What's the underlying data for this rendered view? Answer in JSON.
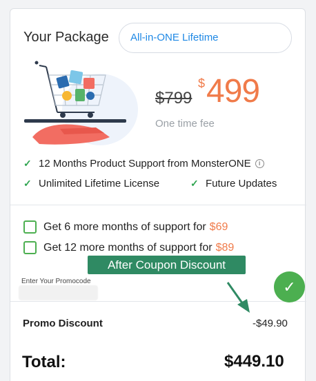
{
  "package": {
    "heading": "Your Package",
    "plan_name": "All-in-ONE Lifetime"
  },
  "pricing": {
    "old_price": "$799",
    "currency": "$",
    "new_price": "499",
    "fee_note": "One time fee"
  },
  "features": [
    {
      "label": "12 Months Product Support from MonsterONE",
      "icon": "check-icon"
    },
    {
      "label": "Unlimited Lifetime License",
      "icon": "check-icon"
    },
    {
      "label": "Future Updates",
      "icon": "check-icon"
    }
  ],
  "info_icon": "i",
  "addons": [
    {
      "label": "Get 6 more months of support for",
      "price": "$69",
      "checked": false
    },
    {
      "label": "Get 12 more months of support for",
      "price": "$89",
      "checked": false
    }
  ],
  "annotation": {
    "banner": "After Coupon Discount"
  },
  "promo": {
    "label": "Enter Your Promocode",
    "value": "",
    "apply_icon": "✓"
  },
  "summary": {
    "discount_label": "Promo Discount",
    "discount_value": "-$49.90",
    "total_label": "Total:",
    "total_value": "$449.10"
  },
  "colors": {
    "accent_orange": "#f07b4a",
    "brand_green": "#4caf50",
    "banner_green": "#2f8a63",
    "link_blue": "#1e88e5"
  }
}
